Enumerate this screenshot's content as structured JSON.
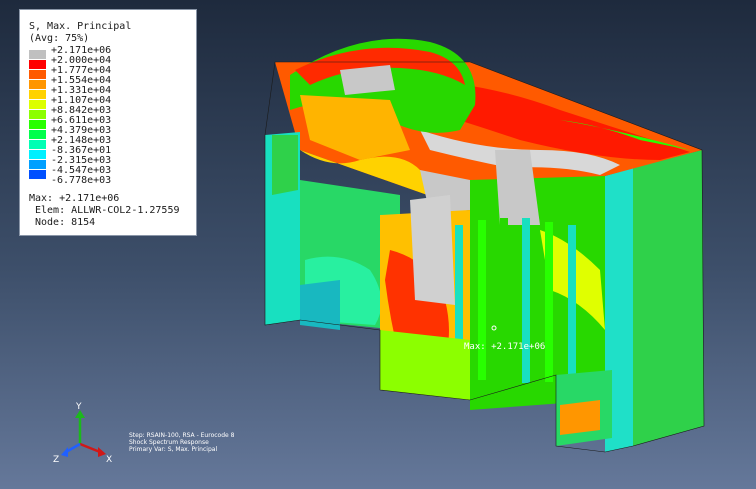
{
  "legend": {
    "title": "S, Max. Principal",
    "subtitle": "(Avg: 75%)",
    "levels": [
      {
        "label": "+2.171e+06",
        "color": "#c0c0c0"
      },
      {
        "label": "+2.000e+04",
        "color": "#ff0000"
      },
      {
        "label": "+1.777e+04",
        "color": "#ff5a00"
      },
      {
        "label": "+1.554e+04",
        "color": "#ff9600"
      },
      {
        "label": "+1.331e+04",
        "color": "#ffd200"
      },
      {
        "label": "+1.107e+04",
        "color": "#dcff00"
      },
      {
        "label": "+8.842e+03",
        "color": "#8cff00"
      },
      {
        "label": "+6.611e+03",
        "color": "#28ff00"
      },
      {
        "label": "+4.379e+03",
        "color": "#00ff4b"
      },
      {
        "label": "+2.148e+03",
        "color": "#00ffb4"
      },
      {
        "label": "-8.367e+01",
        "color": "#00f0ff"
      },
      {
        "label": "-2.315e+03",
        "color": "#00a0ff"
      },
      {
        "label": "-4.547e+03",
        "color": "#0050ff"
      },
      {
        "label": "-6.778e+03",
        "color": "#0000ff"
      }
    ],
    "max_line": "Max: +2.171e+06",
    "elem_line": "Elem: ALLWR-COL2-1.27559",
    "node_line": "Node: 8154"
  },
  "model": {
    "max_marker_label": "Max: +2.171e+06"
  },
  "triad": {
    "x_label": "X",
    "y_label": "Y",
    "z_label": "Z",
    "x_color": "#d01818",
    "y_color": "#1cb81c",
    "z_color": "#2060ff"
  },
  "captions": {
    "step": "Step: RSAIN-100, RSA - Eurocode 8",
    "description": "Shock Spectrum Response",
    "primary_var": "Primary Var: S, Max. Principal"
  }
}
